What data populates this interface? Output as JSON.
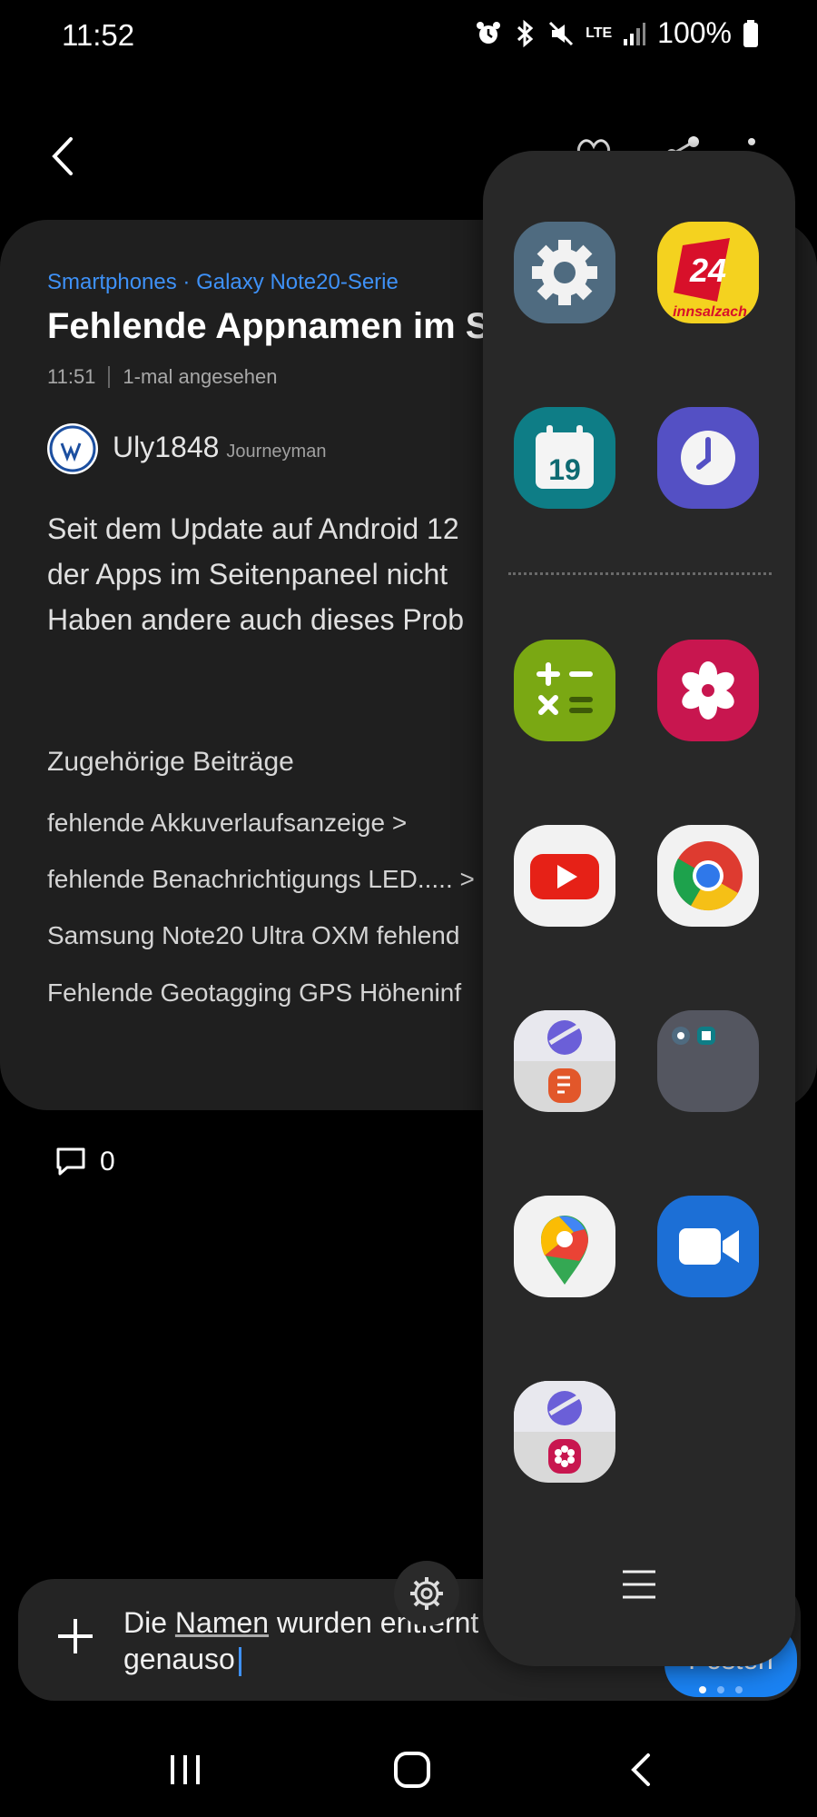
{
  "status_bar": {
    "time": "11:52",
    "battery": "100%",
    "network": "LTE"
  },
  "post": {
    "breadcrumb": "Smartphones · Galaxy Note20-Serie",
    "title": "Fehlende Appnamen im S",
    "time": "11:51",
    "views": "1-mal angesehen",
    "author": "Uly1848",
    "author_rank": "Journeyman",
    "body_lines": [
      "Seit dem Update auf Android 12",
      "der Apps im Seitenpaneel nicht",
      "Haben andere auch dieses Prob"
    ]
  },
  "related": {
    "heading": "Zugehörige Beiträge",
    "items": [
      "fehlende Akkuverlaufsanzeige >",
      "fehlende Benachrichtigungs LED..... >",
      "Samsung Note20 Ultra OXM fehlend",
      "Fehlende Geotagging GPS Höheninf"
    ]
  },
  "comments": {
    "count": "0"
  },
  "composer": {
    "text_part1": "Die ",
    "text_underlined": "Namen",
    "text_part2": " wurden entfernt",
    "text_line2": "genauso",
    "post_label": "Posten"
  },
  "edge_panel": {
    "apps": [
      {
        "name": "settings-icon",
        "label": "Settings"
      },
      {
        "name": "innsalzach24-icon",
        "label": "24",
        "sublabel": "innsalzach"
      },
      {
        "name": "calendar-icon",
        "label": "19"
      },
      {
        "name": "clock-icon",
        "label": "Clock"
      },
      {
        "name": "calculator-icon",
        "label": "Calculator"
      },
      {
        "name": "gallery-icon",
        "label": "Gallery"
      },
      {
        "name": "youtube-icon",
        "label": "YouTube"
      },
      {
        "name": "chrome-icon",
        "label": "Chrome"
      },
      {
        "name": "internet-notes-pair-icon",
        "label": "Pair"
      },
      {
        "name": "folder-icon",
        "label": "Folder"
      },
      {
        "name": "maps-icon",
        "label": "Maps"
      },
      {
        "name": "zoom-icon",
        "label": "Zoom"
      },
      {
        "name": "internet-gallery-pair-icon",
        "label": "Pair"
      }
    ]
  },
  "colors": {
    "accent": "#3e91f7",
    "card": "#1f1f1f",
    "panel": "#282828"
  }
}
